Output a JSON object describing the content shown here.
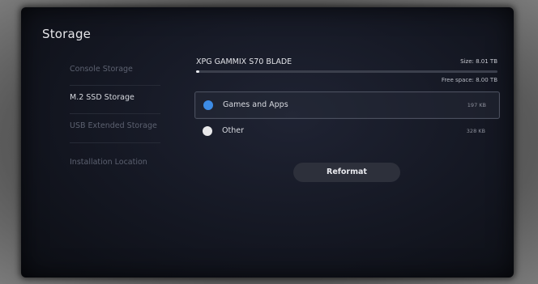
{
  "page": {
    "title": "Storage"
  },
  "sidebar": {
    "items": [
      {
        "label": "Console Storage",
        "active": false
      },
      {
        "label": "M.2 SSD Storage",
        "active": true
      },
      {
        "label": "USB Extended Storage",
        "active": false
      },
      {
        "label": "Installation Location",
        "active": false
      }
    ]
  },
  "drive": {
    "name": "XPG GAMMIX S70 BLADE",
    "size": "Size: 8.01 TB",
    "free_space": "Free space: 8.00 TB",
    "used_fraction": 0.005
  },
  "categories": [
    {
      "label": "Games and Apps",
      "value": "197 KB",
      "color": "#3d8ce6",
      "selected": true
    },
    {
      "label": "Other",
      "value": "328 KB",
      "color": "#e8e8ea",
      "selected": false
    }
  ],
  "actions": {
    "reformat_label": "Reformat"
  }
}
